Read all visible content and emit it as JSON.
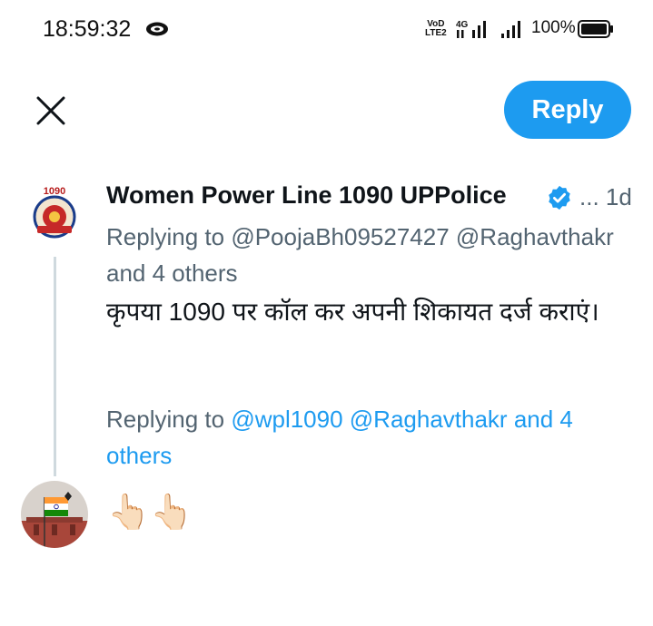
{
  "status_bar": {
    "time": "18:59:32",
    "network_top": "VoD",
    "network_bottom": "LTE2",
    "signal_type": "4G",
    "battery": "100%",
    "icons": [
      "app-notification-icon",
      "signal-4g-icon",
      "signal-bars-icon",
      "battery-icon"
    ]
  },
  "top_bar": {
    "close_icon": "close-icon",
    "reply_button": "Reply",
    "accent_color": "#1d9bf0"
  },
  "tweet": {
    "author_name": "Women Power Line 1090 UPPolice",
    "verified_icon": "verified-badge-icon",
    "time": "... 1d",
    "avatar_text": "1090",
    "replying_prefix": "Replying to ",
    "replying_to": "@PoojaBh09527427 @Raghavthakr and 4 others",
    "text": "कृपया 1090 पर कॉल कर अपनी शिकायत दर्ज कराएं।"
  },
  "compose": {
    "replying_prefix": "Replying to ",
    "mentions": "@wpl1090 @Raghavthakr and 4 others",
    "draft": "👆🏻👆🏻"
  }
}
